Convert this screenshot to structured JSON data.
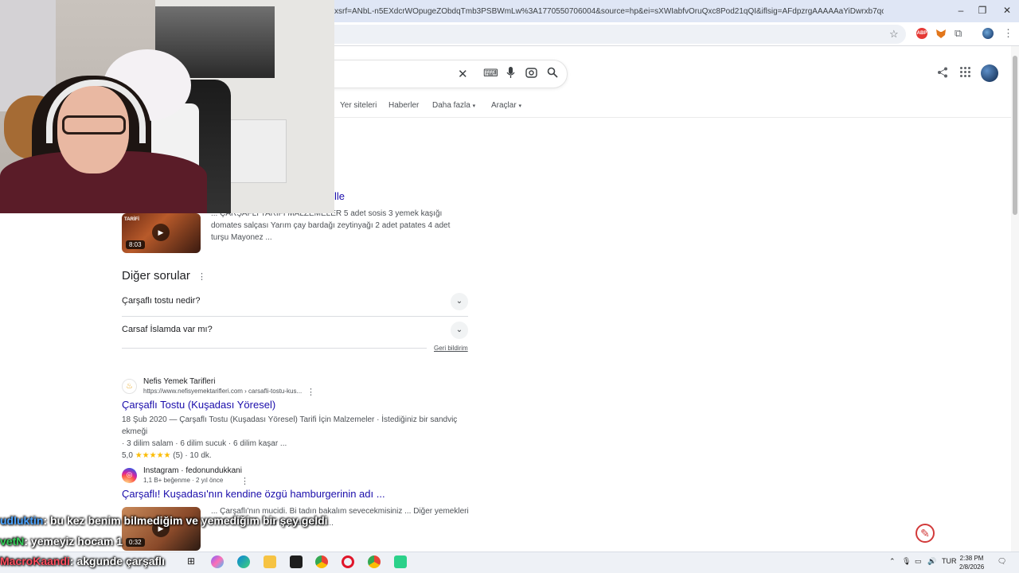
{
  "browser": {
    "url": "xsrf=ANbL-n5EXdcrWOpugeZObdqTmb3PSBWmLw%3A1770550706004&source=hp&ei=sXWIabfvOruQxc8Pod21qQI&iflsig=AFdpzrgAAAAAaYiDwrxb7qo_RGqvnjTg...",
    "window_controls": [
      "–",
      "❐",
      "✕"
    ]
  },
  "google": {
    "tabs": [
      "Yer siteleri",
      "Haberler",
      "Daha fazla",
      "Araçlar"
    ],
    "partial_title": "lle",
    "video_result": {
      "snippet": "... ÇARŞAFLI TARİFİ MALZEMELER 5 adet sosis 3 yemek kaşığı domates salçası Yarım çay bardağı zeytinyağı 2 adet patates 4 adet turşu Mayonez ...",
      "duration": "8:03",
      "thumb_label": "TARİFİ"
    },
    "people_also_ask": {
      "title": "Diğer sorular",
      "questions": [
        "Çarşaflı tostu nedir?",
        "Carsaf İslamda var mı?"
      ],
      "feedback": "Geri bildirim"
    },
    "results": [
      {
        "site": "Nefis Yemek Tarifleri",
        "url": "https://www.nefisyemektarifleri.com › carsafli-tostu-kus...",
        "title": "Çarşaflı Tostu (Kuşadası Yöresel)",
        "snippet_1": "18 Şub 2020 — Çarşaflı Tostu (Kuşadası Yöresel) Tarifi İçin Malzemeler · İstediğiniz bir sandviç ekmeği",
        "snippet_2": "· 3 dilim salam · 6 dilim sucuk · 6 dilim kaşar ...",
        "rating": "5,0",
        "stars": "★★★★★",
        "reviews": "(5)",
        "time": "· 10 dk."
      },
      {
        "site": "Instagram · fedonundukkani",
        "url": "1,1 B+ beğenme · 2 yıl önce",
        "title": "Çarşaflı! Kuşadası'nın kendine özgü hamburgerinin adı ...",
        "snippet_1": "... Çarşaflı'nın mucidi. Bi tadın bakalım sevecekmisiniz ... Diğer yemekleri",
        "snippet_2": "al hayvandandı ...",
        "duration": "0:32"
      }
    ]
  },
  "chat": [
    {
      "user": "udluktin",
      "message": ": bu kez benim bilmediğim ve yemediğim bir şey geldi"
    },
    {
      "user": "vetN",
      "message": ": yemeyiz hocam 1"
    },
    {
      "user": "MacroKaandi",
      "message": ": akgunde çarşaflı"
    }
  ],
  "taskbar": {
    "language": "TUR",
    "time": "2:38 PM",
    "date": "2/8/2026"
  }
}
